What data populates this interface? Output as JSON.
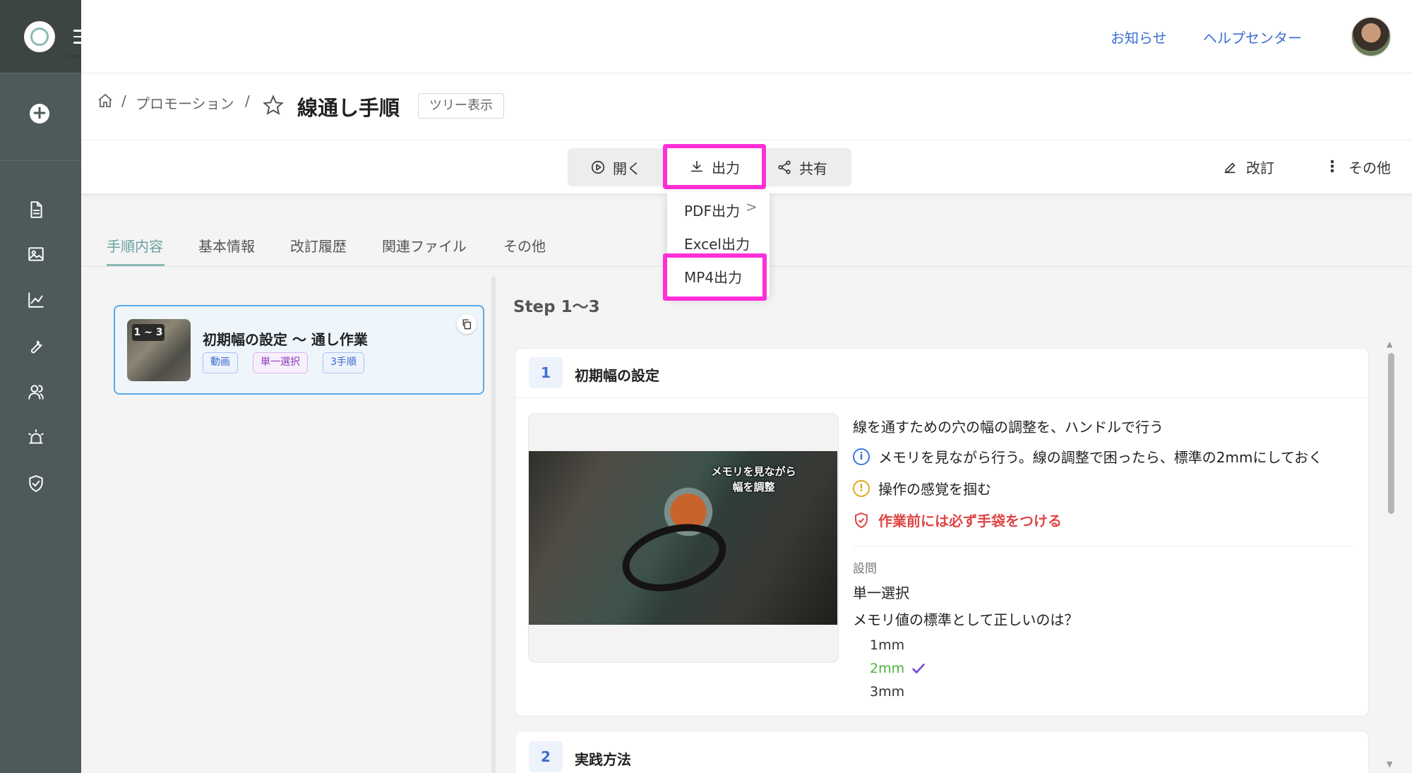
{
  "header": {
    "news_label": "お知らせ",
    "help_label": "ヘルプセンター"
  },
  "breadcrumb": {
    "sep1": "/",
    "category": "プロモーション",
    "sep2": "/",
    "title": "線通し手順",
    "tree_button": "ツリー表示"
  },
  "toolbar": {
    "open_label": "開く",
    "export_label": "出力",
    "share_label": "共有",
    "revise_label": "改訂",
    "more_label": "その他"
  },
  "export_menu": {
    "items": [
      "PDF出力",
      "Excel出力",
      "MP4出力"
    ],
    "submenu_chevron": ">"
  },
  "tabs": {
    "items": [
      "手順内容",
      "基本情報",
      "改訂履歴",
      "関連ファイル",
      "その他"
    ],
    "active": "手順内容"
  },
  "step_list": {
    "card": {
      "badge": "1 ~ 3",
      "title": "初期幅の設定 〜 通し作業",
      "tags": [
        "動画",
        "単一選択",
        "3手順"
      ]
    }
  },
  "content": {
    "step_range": "Step 1〜3",
    "steps": [
      {
        "number": "1",
        "title": "初期幅の設定",
        "video_caption": "メモリを見ながら\n幅を調整",
        "description": "線を通すための穴の幅の調整を、ハンドルで行う",
        "info": "メモリを見ながら行う。線の調整で困ったら、標準の2mmにしておく",
        "caution": "操作の感覚を掴む",
        "warning": "作業前には必ず手袋をつける",
        "question": {
          "label": "設問",
          "type": "単一選択",
          "text": "メモリ値の標準として正しいのは？",
          "options": [
            "1mm",
            "2mm",
            "3mm"
          ],
          "correct": "2mm"
        }
      },
      {
        "number": "2",
        "title": "実践方法"
      }
    ]
  },
  "colors": {
    "sidebar": "#4d5a59",
    "highlight": "#ff2fd8",
    "link": "#3b6fd4",
    "active_tab": "#6aa3a0",
    "warning": "#e04545",
    "correct": "#4fb03f"
  }
}
